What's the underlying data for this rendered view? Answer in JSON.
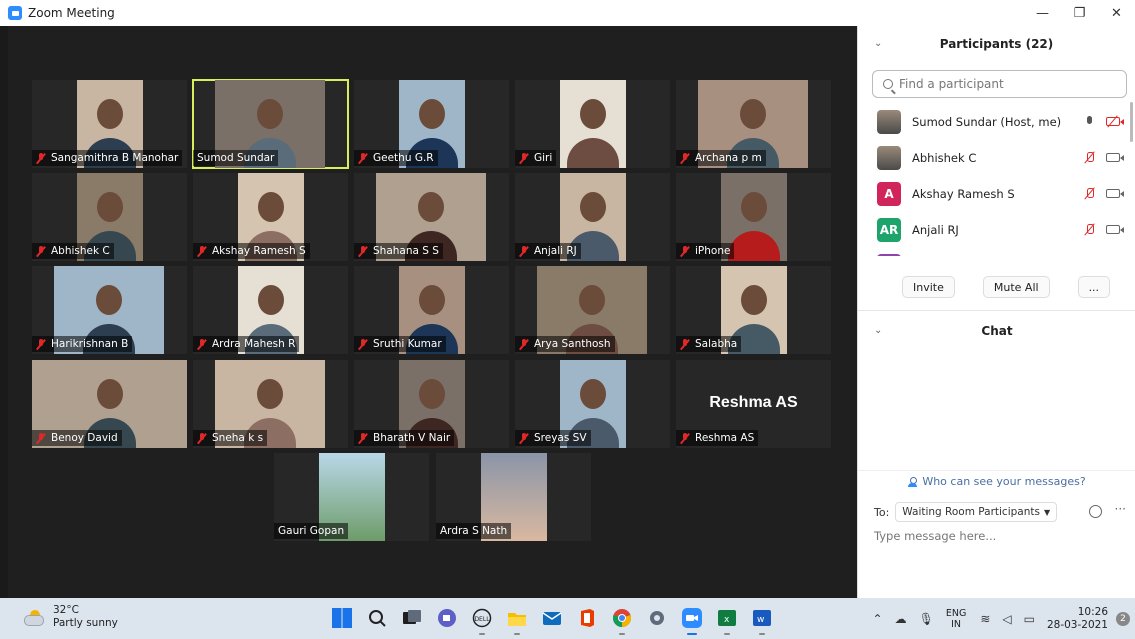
{
  "window": {
    "title": "Zoom Meeting",
    "minimize": "—",
    "restore": "❐",
    "close": "✕"
  },
  "tiles": [
    {
      "name": "Sangamithra B Manohar",
      "muted": true,
      "row": 0,
      "col": 0
    },
    {
      "name": "Sumod Sundar",
      "muted": false,
      "row": 0,
      "col": 1,
      "active": true
    },
    {
      "name": "Geethu G.R",
      "muted": true,
      "row": 0,
      "col": 2
    },
    {
      "name": "Giri",
      "muted": true,
      "row": 0,
      "col": 3
    },
    {
      "name": "Archana p m",
      "muted": true,
      "row": 0,
      "col": 4
    },
    {
      "name": "Abhishek C",
      "muted": true,
      "row": 1,
      "col": 0
    },
    {
      "name": "Akshay Ramesh S",
      "muted": true,
      "row": 1,
      "col": 1
    },
    {
      "name": "Shahana S S",
      "muted": true,
      "row": 1,
      "col": 2
    },
    {
      "name": "Anjali RJ",
      "muted": true,
      "row": 1,
      "col": 3
    },
    {
      "name": "iPhone",
      "muted": true,
      "row": 1,
      "col": 4
    },
    {
      "name": "Harikrishnan B",
      "muted": true,
      "row": 2,
      "col": 0
    },
    {
      "name": "Ardra Mahesh R",
      "muted": true,
      "row": 2,
      "col": 1
    },
    {
      "name": "Sruthi Kumar",
      "muted": true,
      "row": 2,
      "col": 2
    },
    {
      "name": "Arya Santhosh",
      "muted": true,
      "row": 2,
      "col": 3
    },
    {
      "name": "Salabha",
      "muted": true,
      "row": 2,
      "col": 4
    },
    {
      "name": "Benoy David",
      "muted": true,
      "row": 3,
      "col": 0
    },
    {
      "name": "Sneha k s",
      "muted": true,
      "row": 3,
      "col": 1
    },
    {
      "name": "Bharath V Nair",
      "muted": true,
      "row": 3,
      "col": 2
    },
    {
      "name": "Sreyas SV",
      "muted": true,
      "row": 3,
      "col": 3
    },
    {
      "name": "Reshma AS",
      "muted": true,
      "row": 3,
      "col": 4,
      "video_off": true,
      "big_label": "Reshma AS"
    },
    {
      "name": "Gauri Gopan",
      "muted": false,
      "row": 4,
      "col": 0
    },
    {
      "name": "Ardra S Nath",
      "muted": false,
      "row": 4,
      "col": 1
    }
  ],
  "participants_panel": {
    "title": "Participants (22)",
    "search_placeholder": "Find a participant",
    "list": [
      {
        "name": "Sumod Sundar (Host, me)",
        "avatar": "photo",
        "mic": "on",
        "camera": "off"
      },
      {
        "name": "Abhishek C",
        "avatar": "photo",
        "mic": "muted",
        "camera": "on"
      },
      {
        "name": "Akshay Ramesh S",
        "avatar": "A",
        "avatar_color": "#d0245a",
        "mic": "muted",
        "camera": "on"
      },
      {
        "name": "Anjali RJ",
        "avatar": "AR",
        "avatar_color": "#1ea36b",
        "mic": "muted",
        "camera": "on"
      }
    ],
    "buttons": {
      "invite": "Invite",
      "mute_all": "Mute All",
      "more": "..."
    }
  },
  "chat_panel": {
    "title": "Chat",
    "who_can_see": "Who can see your messages?",
    "to_label": "To:",
    "recipient": "Waiting Room Participants",
    "placeholder": "Type message here...",
    "more": "···"
  },
  "taskbar": {
    "weather_temp": "32°C",
    "weather_desc": "Partly sunny",
    "lang_top": "ENG",
    "lang_bottom": "IN",
    "time": "10:26",
    "date": "28-03-2021",
    "notification_count": "2"
  }
}
